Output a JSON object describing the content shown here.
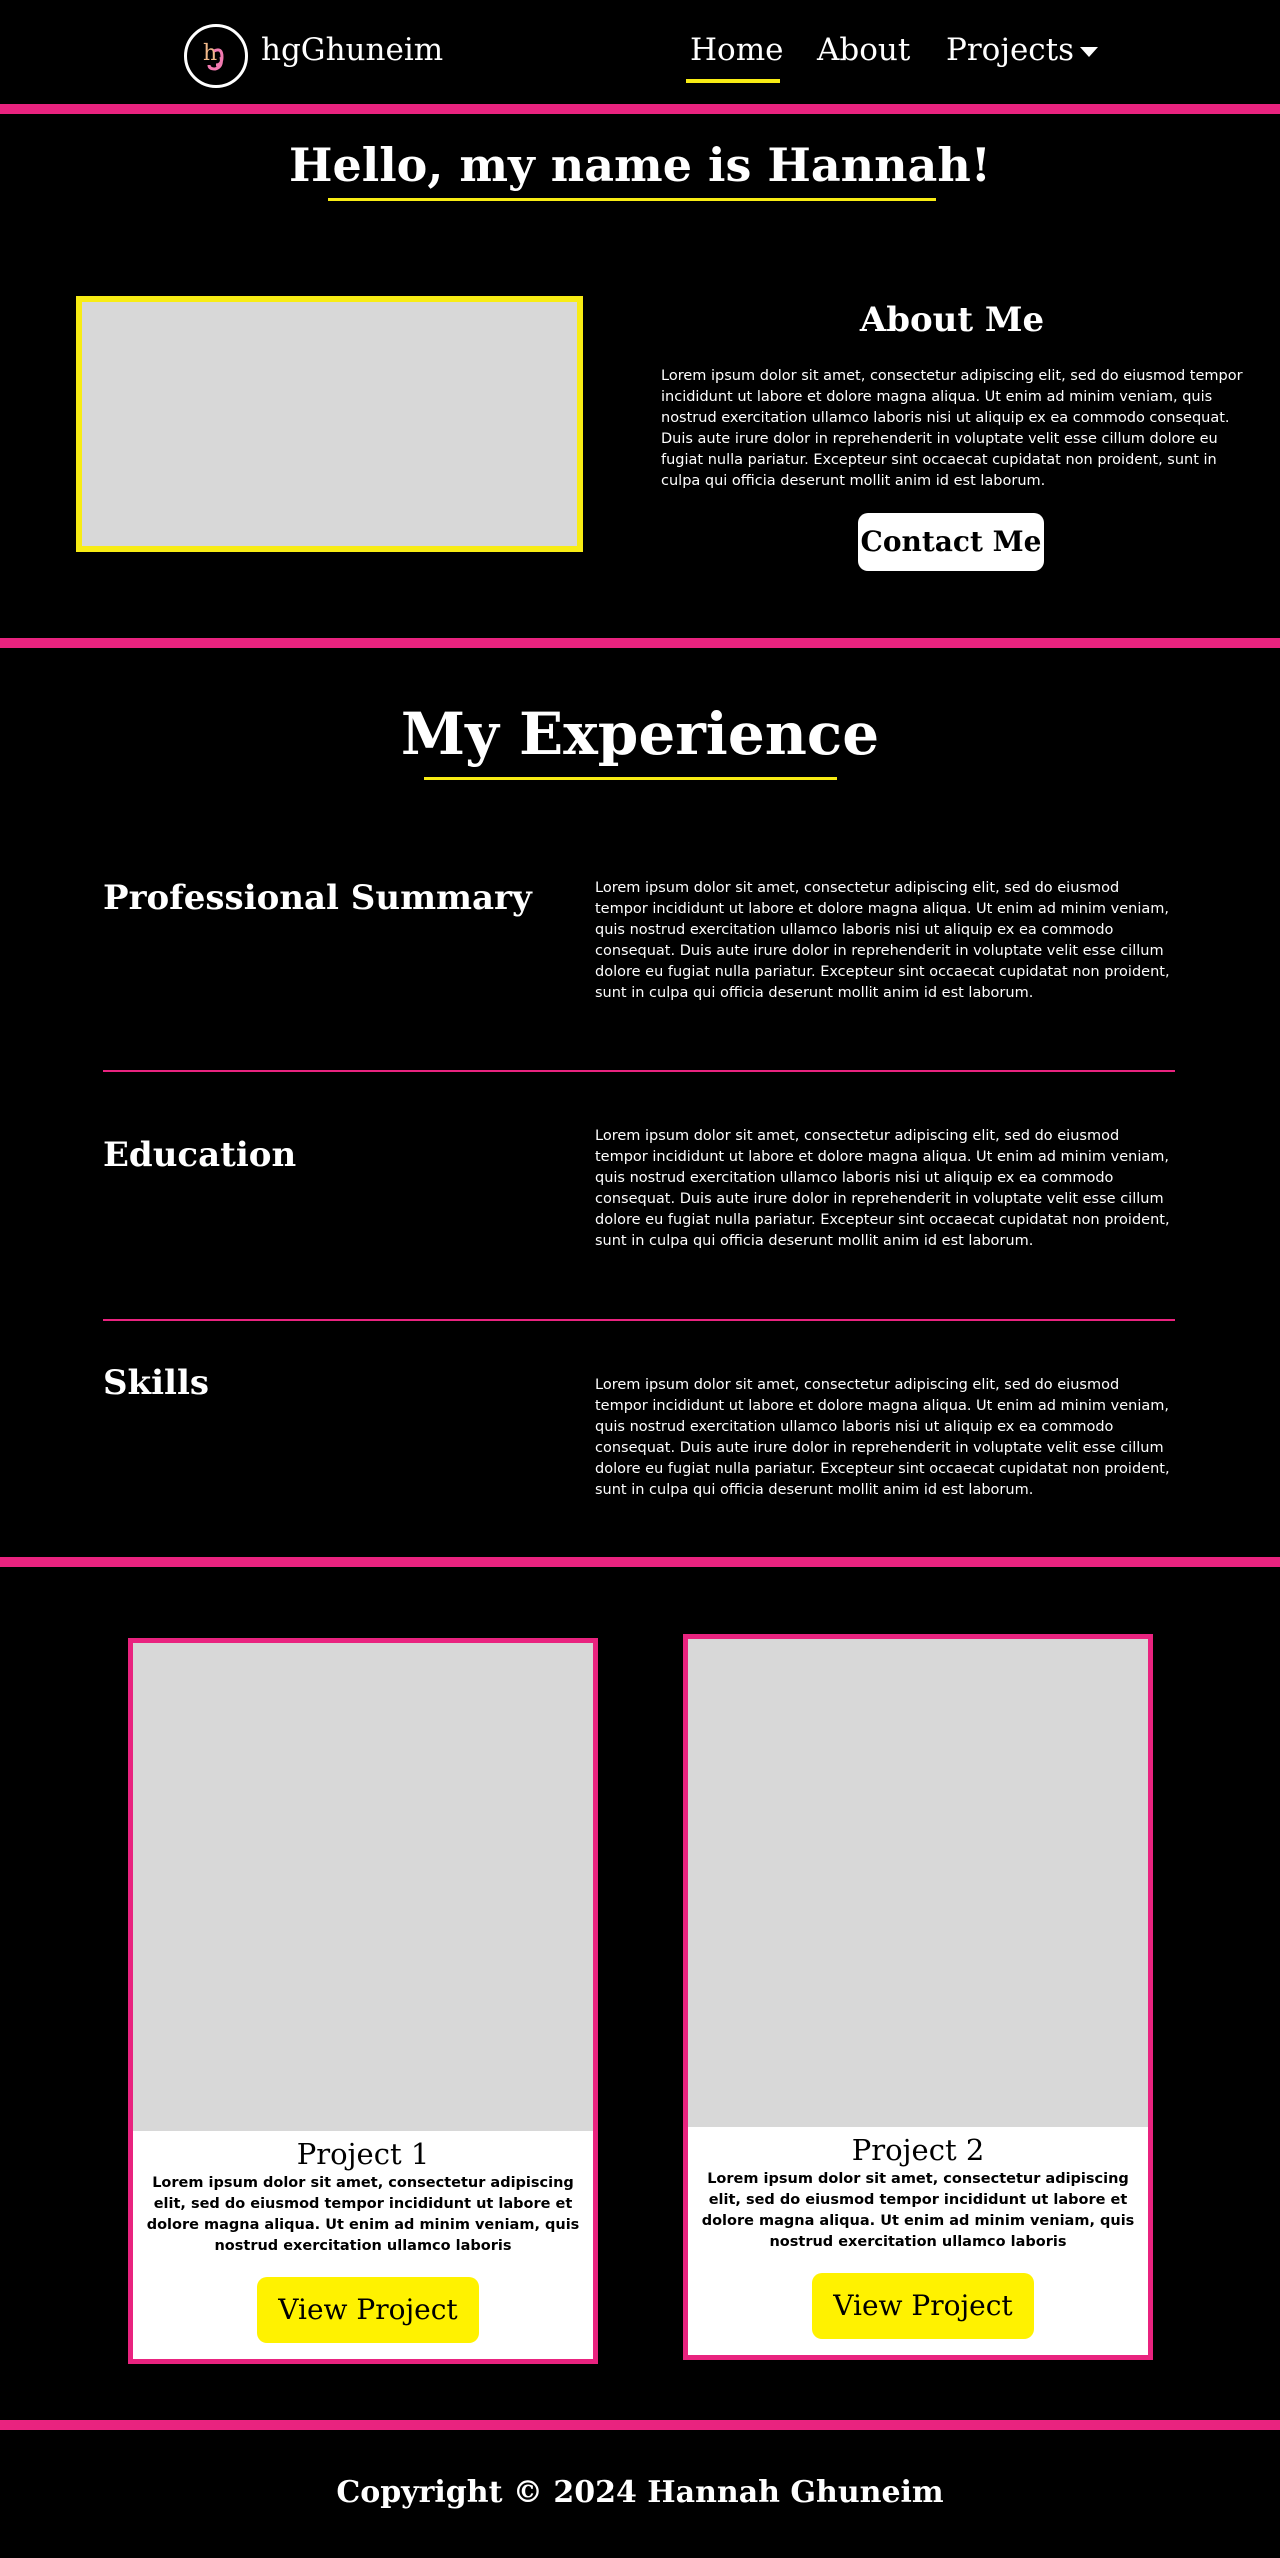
{
  "colors": {
    "accent_pink": "#e9237f",
    "accent_yellow": "#f8ec14",
    "button_yellow": "#fff200",
    "placeholder_gray": "#d8d8d8",
    "background": "#000000"
  },
  "nav": {
    "logo_icon": "hg-monogram-logo",
    "brand": "hgGhuneim",
    "links": {
      "home": "Home",
      "about": "About",
      "projects": "Projects"
    },
    "projects_icon": "caret-down-icon"
  },
  "hero": {
    "title": "Hello, my name is Hannah!",
    "about_title": "About Me",
    "about_text": "Lorem ipsum dolor sit amet, consectetur adipiscing elit, sed do eiusmod tempor incididunt ut labore et dolore magna aliqua. Ut enim ad minim veniam, quis nostrud exercitation ullamco laboris nisi ut aliquip ex ea commodo consequat. Duis aute irure dolor in reprehenderit in voluptate velit esse cillum dolore eu fugiat nulla pariatur. Excepteur sint occaecat cupidatat non proident, sunt in culpa qui officia deserunt mollit anim id est laborum.",
    "contact_button": "Contact Me"
  },
  "experience": {
    "title": "My Experience",
    "sections": [
      {
        "heading": "Professional Summary",
        "text": "Lorem ipsum dolor sit amet, consectetur adipiscing elit, sed do eiusmod tempor incididunt ut labore et dolore magna aliqua. Ut enim ad minim veniam, quis nostrud exercitation ullamco laboris nisi ut aliquip ex ea commodo consequat. Duis aute irure dolor in reprehenderit in voluptate velit esse cillum dolore eu fugiat nulla pariatur. Excepteur sint occaecat cupidatat non proident, sunt in culpa qui officia deserunt mollit anim id est laborum."
      },
      {
        "heading": "Education",
        "text": "Lorem ipsum dolor sit amet, consectetur adipiscing elit, sed do eiusmod tempor incididunt ut labore et dolore magna aliqua. Ut enim ad minim veniam, quis nostrud exercitation ullamco laboris nisi ut aliquip ex ea commodo consequat. Duis aute irure dolor in reprehenderit in voluptate velit esse cillum dolore eu fugiat nulla pariatur. Excepteur sint occaecat cupidatat non proident, sunt in culpa qui officia deserunt mollit anim id est laborum."
      },
      {
        "heading": "Skills",
        "text": "Lorem ipsum dolor sit amet, consectetur adipiscing elit, sed do eiusmod tempor incididunt ut labore et dolore magna aliqua. Ut enim ad minim veniam, quis nostrud exercitation ullamco laboris nisi ut aliquip ex ea commodo consequat. Duis aute irure dolor in reprehenderit in voluptate velit esse cillum dolore eu fugiat nulla pariatur. Excepteur sint occaecat cupidatat non proident, sunt in culpa qui officia deserunt mollit anim id est laborum."
      }
    ]
  },
  "projects": [
    {
      "title": "Project 1",
      "text": "Lorem ipsum dolor sit amet, consectetur adipiscing elit, sed do eiusmod tempor incididunt ut labore et dolore magna aliqua. Ut enim ad minim veniam, quis nostrud exercitation ullamco laboris",
      "button": "View Project"
    },
    {
      "title": "Project 2",
      "text": "Lorem ipsum dolor sit amet, consectetur adipiscing elit, sed do eiusmod tempor incididunt ut labore et dolore magna aliqua. Ut enim ad minim veniam, quis nostrud exercitation ullamco laboris",
      "button": "View Project"
    }
  ],
  "footer": {
    "copyright": "Copyright © 2024 Hannah Ghuneim"
  }
}
